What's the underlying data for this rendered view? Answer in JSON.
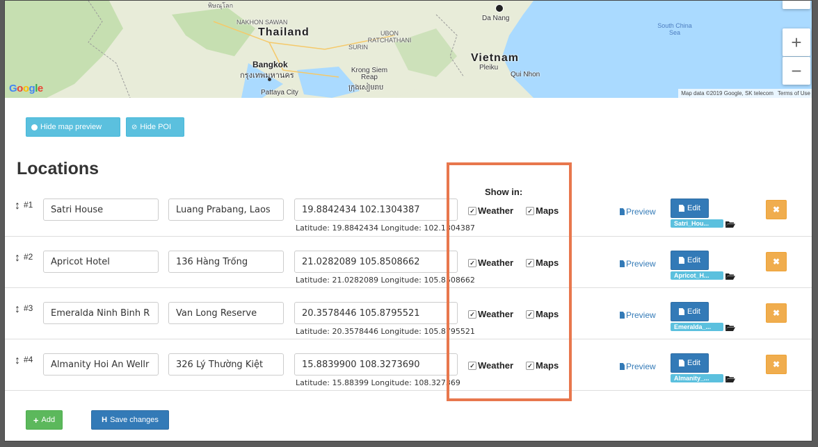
{
  "map": {
    "labels": {
      "thailand": "Thailand",
      "vietnam": "Vietnam",
      "bangkok": "Bangkok",
      "bangkok_thai": "กรุงเทพมหานคร",
      "pattaya": "Pattaya City",
      "nakhon": "NAKHON SAWAN",
      "ubon": "UBON RATCHATHANI",
      "surin": "SURIN",
      "krong": "Krong Siem Reap",
      "krong_khmer": "ក្រុងសៀមរាប",
      "da_nang": "Da Nang",
      "pleiku": "Pleiku",
      "qui_nhon": "Qui Nhon",
      "south_china_sea": "South China Sea",
      "top_cut": "พิษณุโลก"
    },
    "logo": {
      "g1": "G",
      "o1": "o",
      "o2": "o",
      "g2": "g",
      "l": "l",
      "e": "e"
    },
    "zoom_in": "+",
    "zoom_out": "−",
    "attribution": "Map data ©2019 Google, SK telecom",
    "terms": "Terms of Use",
    "colors": {
      "water": "#aadaff",
      "land": "#e8ecd9",
      "forest": "#c6dfb1"
    }
  },
  "toolbar": {
    "hide_map_label": "Hide map preview",
    "hide_poi_label": "Hide POI"
  },
  "heading": "Locations",
  "show_in_label": "Show in:",
  "rows": [
    {
      "num": "#1",
      "name": "Satri House",
      "address": "Luang Prabang, Laos",
      "latlong": "19.8842434 102.1304387",
      "info": "Latitude: 19.8842434 Longitude: 102.1304387",
      "weather": "Weather",
      "maps": "Maps",
      "preview": "Preview",
      "edit": "Edit",
      "tag": "Satri_Hou..."
    },
    {
      "num": "#2",
      "name": "Apricot Hotel",
      "address": "136 Hàng Trống",
      "latlong": "21.0282089 105.8508662",
      "info": "Latitude: 21.0282089 Longitude: 105.8508662",
      "weather": "Weather",
      "maps": "Maps",
      "preview": "Preview",
      "edit": "Edit",
      "tag": "Apricot_H..."
    },
    {
      "num": "#3",
      "name": "Emeralda Ninh Binh R",
      "address": "Van Long Reserve",
      "latlong": "20.3578446 105.8795521",
      "info": "Latitude: 20.3578446 Longitude: 105.8795521",
      "weather": "Weather",
      "maps": "Maps",
      "preview": "Preview",
      "edit": "Edit",
      "tag": "Emeralda_..."
    },
    {
      "num": "#4",
      "name": "Almanity Hoi An Wellr",
      "address": "326 Lý Thường Kiệt",
      "latlong": "15.8839900 108.3273690",
      "info": "Latitude: 15.88399 Longitude: 108.327369",
      "weather": "Weather",
      "maps": "Maps",
      "preview": "Preview",
      "edit": "Edit",
      "tag": "Almanity_..."
    }
  ],
  "footer": {
    "add_label": "Add",
    "save_label": "Save changes"
  }
}
